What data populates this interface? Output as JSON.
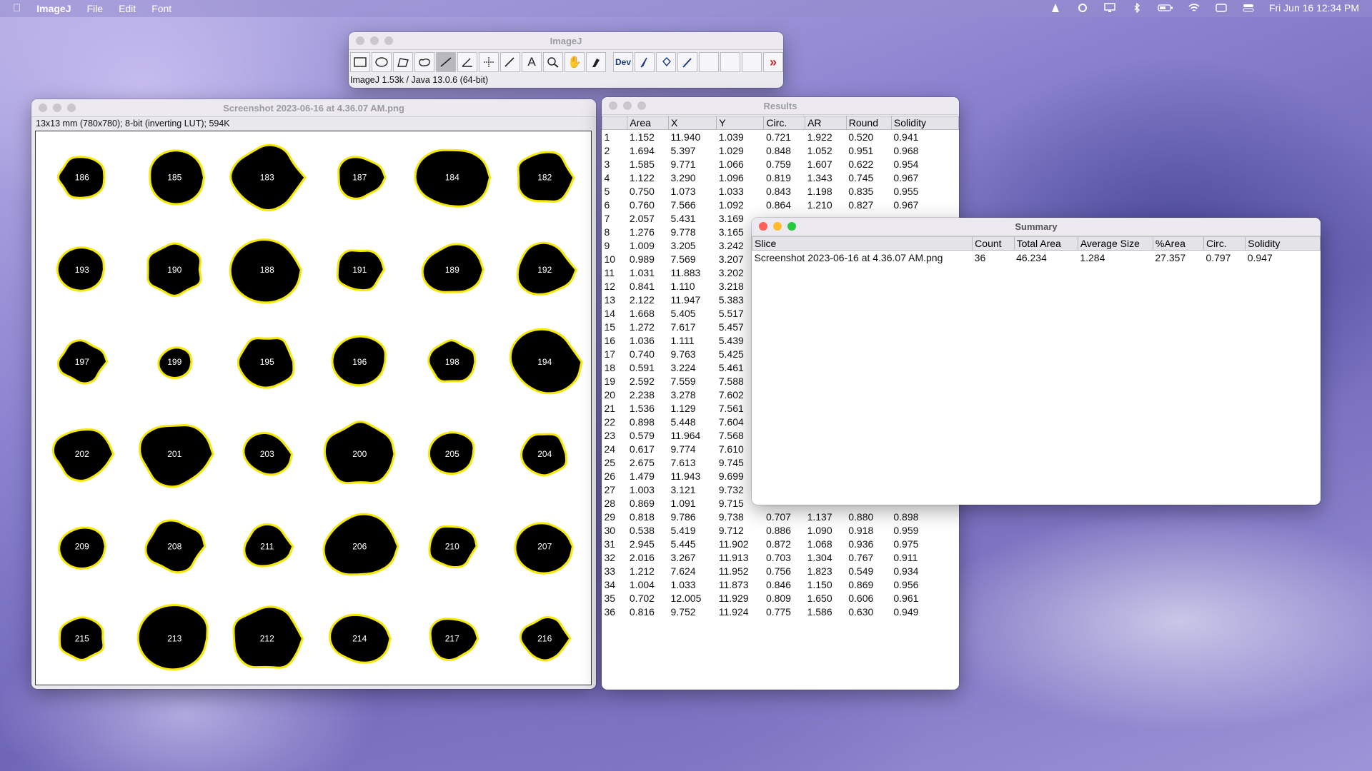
{
  "menubar": {
    "app": "ImageJ",
    "items": [
      "File",
      "Edit",
      "Font"
    ],
    "datetime": "Fri Jun 16  12:34 PM"
  },
  "toolbar": {
    "title": "ImageJ",
    "dev_label": "Dev",
    "status": "ImageJ 1.53k / Java 13.0.6 (64-bit)",
    "tools": [
      "rectangle",
      "oval",
      "polygon",
      "freehand",
      "straight-line",
      "angle",
      "point",
      "wand",
      "text",
      "magnifier",
      "scroll",
      "color-picker",
      "dev",
      "brush",
      "flood-fill",
      "dropper",
      "blank1",
      "blank2",
      "blank3",
      "more"
    ]
  },
  "image_window": {
    "title": "Screenshot 2023-06-16 at 4.36.07 AM.png",
    "info": "13x13 mm (780x780); 8-bit (inverting LUT); 594K",
    "particles": [
      {
        "id": "186",
        "size": "small"
      },
      {
        "id": "185",
        "size": "medium"
      },
      {
        "id": "183",
        "size": "large"
      },
      {
        "id": "187",
        "size": "small"
      },
      {
        "id": "184",
        "size": "large"
      },
      {
        "id": "182",
        "size": "medium"
      },
      {
        "id": "193",
        "size": "small"
      },
      {
        "id": "190",
        "size": "medium"
      },
      {
        "id": "188",
        "size": "large"
      },
      {
        "id": "191",
        "size": "small"
      },
      {
        "id": "189",
        "size": "medium"
      },
      {
        "id": "192",
        "size": "medium"
      },
      {
        "id": "197",
        "size": "small"
      },
      {
        "id": "199",
        "size": "tiny"
      },
      {
        "id": "195",
        "size": "medium"
      },
      {
        "id": "196",
        "size": "medium"
      },
      {
        "id": "198",
        "size": "small"
      },
      {
        "id": "194",
        "size": "large"
      },
      {
        "id": "202",
        "size": "medium"
      },
      {
        "id": "201",
        "size": "large"
      },
      {
        "id": "203",
        "size": "small"
      },
      {
        "id": "200",
        "size": "large"
      },
      {
        "id": "205",
        "size": "small"
      },
      {
        "id": "204",
        "size": "small"
      },
      {
        "id": "209",
        "size": "small"
      },
      {
        "id": "208",
        "size": "medium"
      },
      {
        "id": "211",
        "size": "small"
      },
      {
        "id": "206",
        "size": "large"
      },
      {
        "id": "210",
        "size": "small"
      },
      {
        "id": "207",
        "size": "medium"
      },
      {
        "id": "215",
        "size": "small"
      },
      {
        "id": "213",
        "size": "large"
      },
      {
        "id": "212",
        "size": "large"
      },
      {
        "id": "214",
        "size": "medium"
      },
      {
        "id": "217",
        "size": "small"
      },
      {
        "id": "216",
        "size": "small"
      }
    ]
  },
  "results": {
    "title": "Results",
    "columns": [
      "",
      "Area",
      "X",
      "Y",
      "Circ.",
      "AR",
      "Round",
      "Solidity"
    ],
    "rows": [
      [
        "1",
        "1.152",
        "11.940",
        "1.039",
        "0.721",
        "1.922",
        "0.520",
        "0.941"
      ],
      [
        "2",
        "1.694",
        "5.397",
        "1.029",
        "0.848",
        "1.052",
        "0.951",
        "0.968"
      ],
      [
        "3",
        "1.585",
        "9.771",
        "1.066",
        "0.759",
        "1.607",
        "0.622",
        "0.954"
      ],
      [
        "4",
        "1.122",
        "3.290",
        "1.096",
        "0.819",
        "1.343",
        "0.745",
        "0.967"
      ],
      [
        "5",
        "0.750",
        "1.073",
        "1.033",
        "0.843",
        "1.198",
        "0.835",
        "0.955"
      ],
      [
        "6",
        "0.760",
        "7.566",
        "1.092",
        "0.864",
        "1.210",
        "0.827",
        "0.967"
      ],
      [
        "7",
        "2.057",
        "5.431",
        "3.169",
        "",
        "",
        "",
        ""
      ],
      [
        "8",
        "1.276",
        "9.778",
        "3.165",
        "",
        "",
        "",
        ""
      ],
      [
        "9",
        "1.009",
        "3.205",
        "3.242",
        "",
        "",
        "",
        ""
      ],
      [
        "10",
        "0.989",
        "7.569",
        "3.207",
        "",
        "",
        "",
        ""
      ],
      [
        "11",
        "1.031",
        "11.883",
        "3.202",
        "",
        "",
        "",
        ""
      ],
      [
        "12",
        "0.841",
        "1.110",
        "3.218",
        "",
        "",
        "",
        ""
      ],
      [
        "13",
        "2.122",
        "11.947",
        "5.383",
        "",
        "",
        "",
        ""
      ],
      [
        "14",
        "1.668",
        "5.405",
        "5.517",
        "",
        "",
        "",
        ""
      ],
      [
        "15",
        "1.272",
        "7.617",
        "5.457",
        "",
        "",
        "",
        ""
      ],
      [
        "16",
        "1.036",
        "1.111",
        "5.439",
        "",
        "",
        "",
        ""
      ],
      [
        "17",
        "0.740",
        "9.763",
        "5.425",
        "",
        "",
        "",
        ""
      ],
      [
        "18",
        "0.591",
        "3.224",
        "5.461",
        "",
        "",
        "",
        ""
      ],
      [
        "19",
        "2.592",
        "7.559",
        "7.588",
        "",
        "",
        "",
        ""
      ],
      [
        "20",
        "2.238",
        "3.278",
        "7.602",
        "",
        "",
        "",
        ""
      ],
      [
        "21",
        "1.536",
        "1.129",
        "7.561",
        "",
        "",
        "",
        ""
      ],
      [
        "22",
        "0.898",
        "5.448",
        "7.604",
        "",
        "",
        "",
        ""
      ],
      [
        "23",
        "0.579",
        "11.964",
        "7.568",
        "",
        "",
        "",
        ""
      ],
      [
        "24",
        "0.617",
        "9.774",
        "7.610",
        "",
        "",
        "",
        ""
      ],
      [
        "25",
        "2.675",
        "7.613",
        "9.745",
        "",
        "",
        "",
        ""
      ],
      [
        "26",
        "1.479",
        "11.943",
        "9.699",
        "",
        "",
        "",
        ""
      ],
      [
        "27",
        "1.003",
        "3.121",
        "9.732",
        "",
        "",
        "",
        ""
      ],
      [
        "28",
        "0.869",
        "1.091",
        "9.715",
        "",
        "",
        "",
        ""
      ],
      [
        "29",
        "0.818",
        "9.786",
        "9.738",
        "0.707",
        "1.137",
        "0.880",
        "0.898"
      ],
      [
        "30",
        "0.538",
        "5.419",
        "9.712",
        "0.886",
        "1.090",
        "0.918",
        "0.959"
      ],
      [
        "31",
        "2.945",
        "5.445",
        "11.902",
        "0.872",
        "1.068",
        "0.936",
        "0.975"
      ],
      [
        "32",
        "2.016",
        "3.267",
        "11.913",
        "0.703",
        "1.304",
        "0.767",
        "0.911"
      ],
      [
        "33",
        "1.212",
        "7.624",
        "11.952",
        "0.756",
        "1.823",
        "0.549",
        "0.934"
      ],
      [
        "34",
        "1.004",
        "1.033",
        "11.873",
        "0.846",
        "1.150",
        "0.869",
        "0.956"
      ],
      [
        "35",
        "0.702",
        "12.005",
        "11.929",
        "0.809",
        "1.650",
        "0.606",
        "0.961"
      ],
      [
        "36",
        "0.816",
        "9.752",
        "11.924",
        "0.775",
        "1.586",
        "0.630",
        "0.949"
      ]
    ]
  },
  "summary": {
    "title": "Summary",
    "columns": [
      "Slice",
      "Count",
      "Total Area",
      "Average Size",
      "%Area",
      "Circ.",
      "Solidity"
    ],
    "row": [
      "Screenshot 2023-06-16 at 4.36.07 AM.png",
      "36",
      "46.234",
      "1.284",
      "27.357",
      "0.797",
      "0.947"
    ]
  }
}
